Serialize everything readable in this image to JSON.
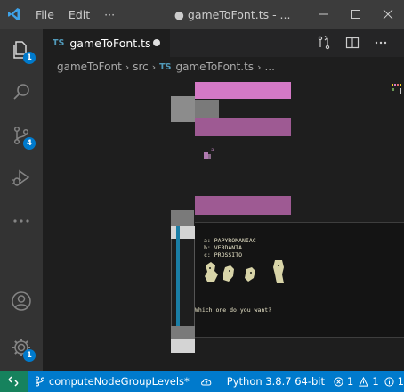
{
  "titlebar": {
    "menu": [
      "File",
      "Edit",
      "···"
    ],
    "title": "● gameToFont.ts - ...",
    "controls": [
      "minimize",
      "maximize",
      "close"
    ]
  },
  "activitybar": {
    "items": [
      {
        "name": "explorer",
        "badge": "1"
      },
      {
        "name": "search",
        "badge": ""
      },
      {
        "name": "source-control",
        "badge": "4"
      },
      {
        "name": "run-debug",
        "badge": ""
      },
      {
        "name": "more",
        "badge": ""
      }
    ],
    "bottom": [
      {
        "name": "accounts",
        "badge": ""
      },
      {
        "name": "manage",
        "badge": "1"
      }
    ]
  },
  "tab": {
    "icon_text": "TS",
    "label": "gameToFont.ts",
    "modified": true
  },
  "breadcrumb": {
    "items": [
      "gameToFont",
      "src",
      "gameToFont.ts",
      "..."
    ],
    "file_icon_text": "TS"
  },
  "game_screen": {
    "options": [
      "a: PAPYROMANIAC",
      "b: VERDANTA",
      "c: PROSSITO"
    ],
    "prompt": "Which one do you want?",
    "tiny_label": "a"
  },
  "statusbar": {
    "branch": "computeNodeGroupLevels*",
    "python": "Python 3.8.7 64-bit",
    "errors": "1",
    "warnings": "1",
    "info": "1"
  },
  "colors": {
    "accent": "#007acc",
    "remote": "#16825d",
    "pink": "#d479c6",
    "pink_dim": "#9e5a93",
    "teal": "#1a7ea6"
  }
}
